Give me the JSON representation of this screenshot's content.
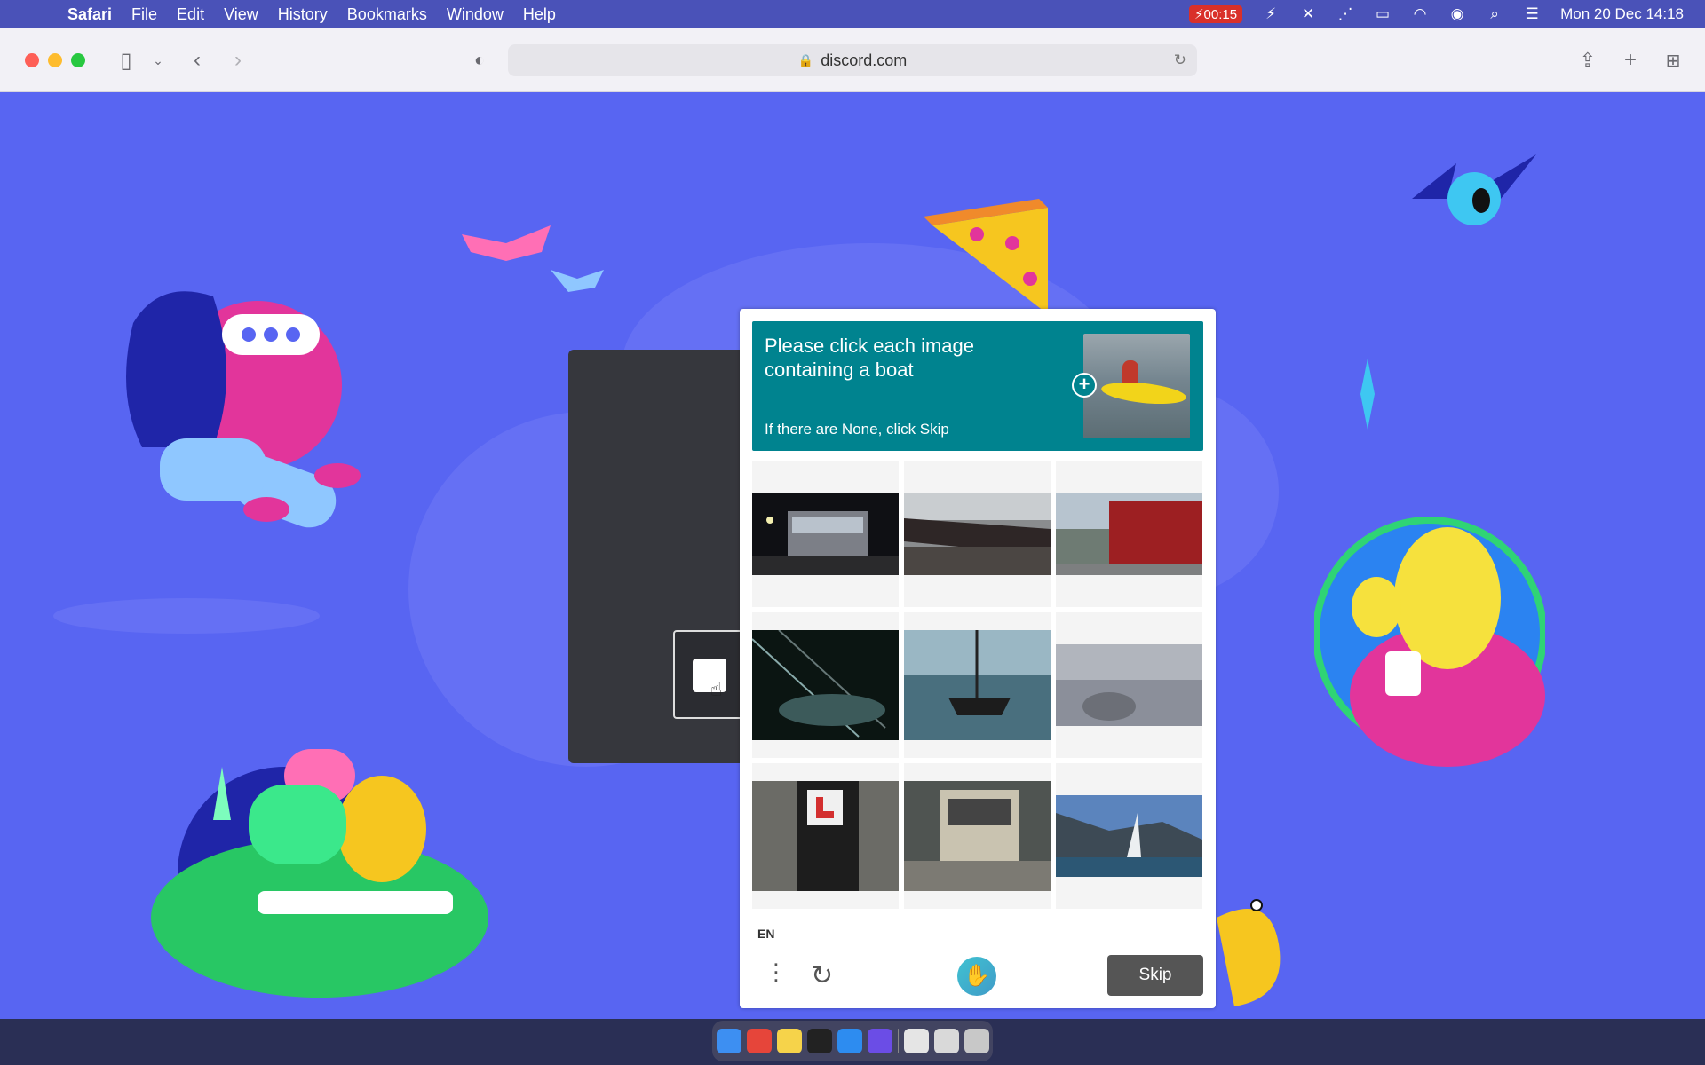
{
  "menubar": {
    "app_name": "Safari",
    "menus": [
      "File",
      "Edit",
      "View",
      "History",
      "Bookmarks",
      "Window",
      "Help"
    ],
    "recording_time": "00:15",
    "datetime": "Mon 20 Dec  14:18"
  },
  "browser": {
    "url": "discord.com"
  },
  "captcha": {
    "prompt_line1": "Please click each image",
    "prompt_line2": "containing a boat",
    "hint": "If there are None, click Skip",
    "language": "EN",
    "skip_label": "Skip",
    "tiles": [
      {
        "name": "bus-at-night"
      },
      {
        "name": "train"
      },
      {
        "name": "fire-truck"
      },
      {
        "name": "dark-boat-rigging"
      },
      {
        "name": "sailboat-on-water"
      },
      {
        "name": "airplane-engine"
      },
      {
        "name": "motorcycle"
      },
      {
        "name": "truck"
      },
      {
        "name": "windsurfer"
      }
    ]
  },
  "colors": {
    "page_background": "#5865f2",
    "captcha_prompt": "#00838f",
    "skip_button": "#555555"
  }
}
